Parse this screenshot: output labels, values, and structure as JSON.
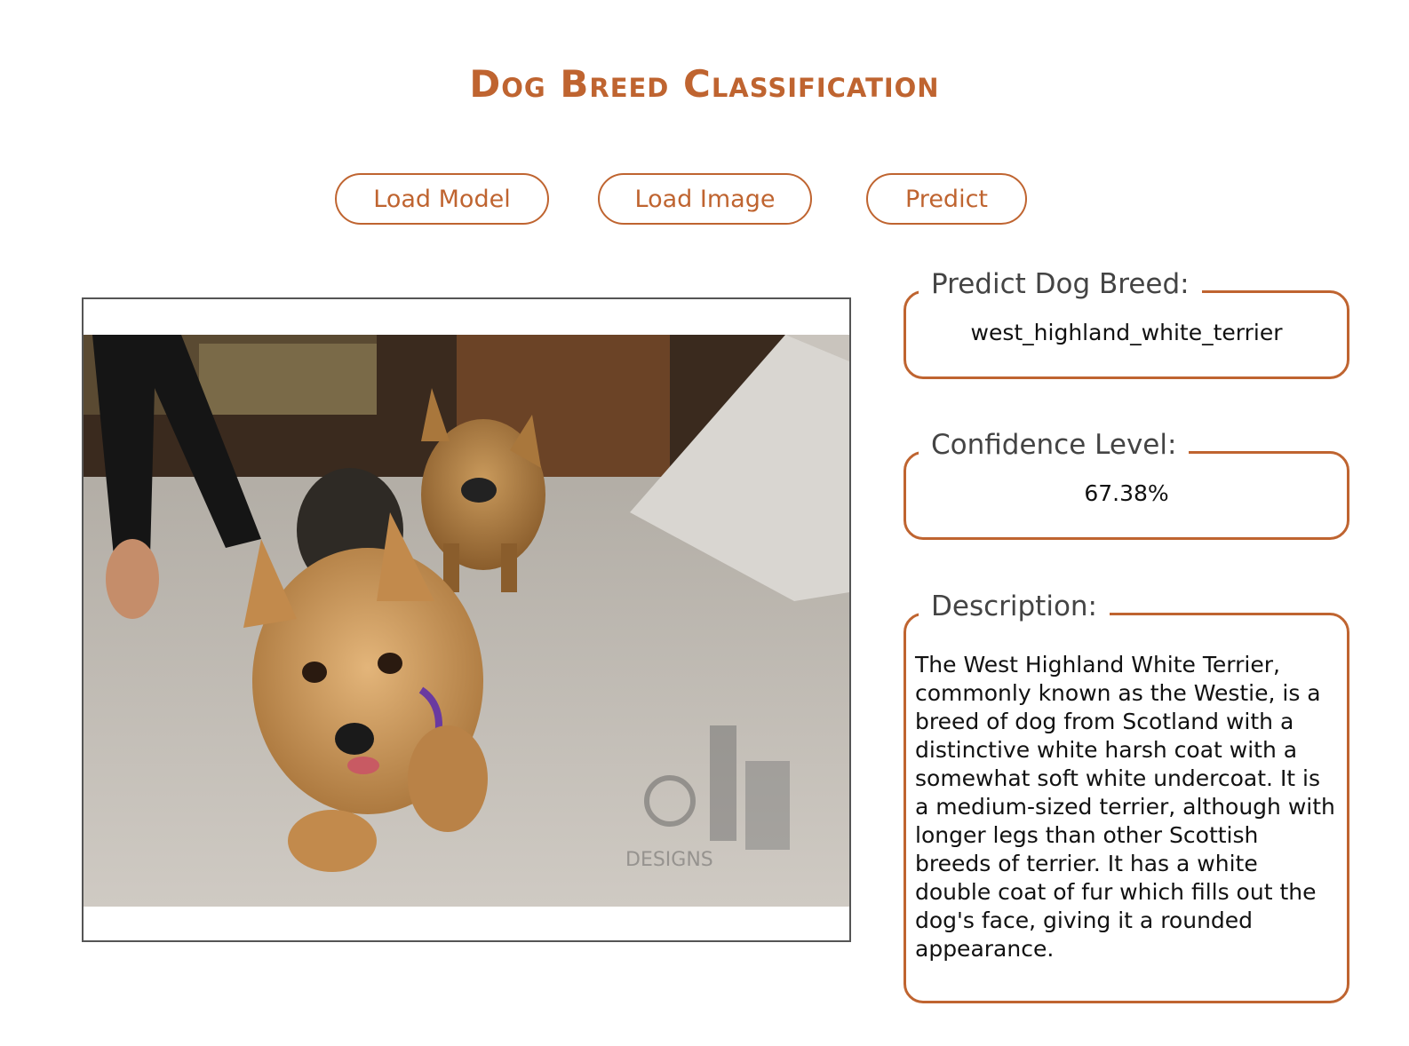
{
  "header": {
    "title": "Dog Breed Classification"
  },
  "toolbar": {
    "load_model_label": "Load Model",
    "load_image_label": "Load Image",
    "predict_label": "Predict"
  },
  "image": {
    "watermark_text": "DESIGNS"
  },
  "results": {
    "breed": {
      "label": "Predict Dog Breed:",
      "value": "west_highland_white_terrier"
    },
    "confidence": {
      "label": "Confidence Level:",
      "value": "67.38%"
    },
    "description": {
      "label": "Description:",
      "value": "The West Highland White Terrier, commonly known as the Westie, is a breed of dog from Scotland with a distinctive white harsh coat with a somewhat soft white undercoat. It is a medium-sized terrier, although with longer legs than other Scottish breeds of terrier. It has a white double coat of fur which fills out the dog's face, giving it a rounded appearance."
    }
  },
  "colors": {
    "accent": "#bf6430",
    "frame": "#555555"
  }
}
